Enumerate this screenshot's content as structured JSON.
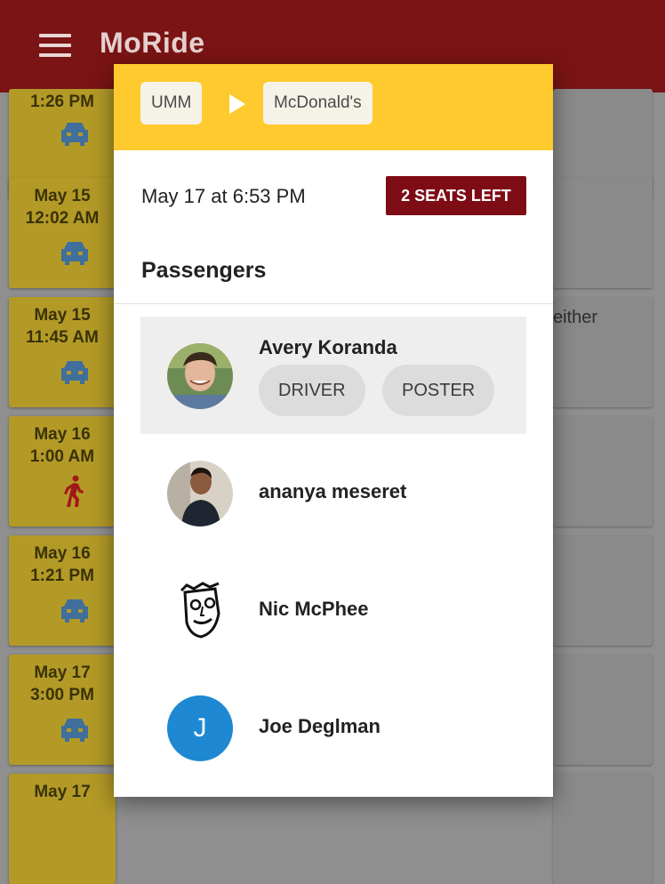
{
  "app": {
    "title": "MoRide"
  },
  "ride_list": [
    {
      "date": "",
      "time": "1:26 PM",
      "mode": "car"
    },
    {
      "date": "May 15",
      "time": "12:02 AM",
      "mode": "car"
    },
    {
      "date": "May 15",
      "time": "11:45 AM",
      "mode": "car",
      "side_text": "either"
    },
    {
      "date": "May 16",
      "time": "1:00 AM",
      "mode": "walk"
    },
    {
      "date": "May 16",
      "time": "1:21 PM",
      "mode": "car"
    },
    {
      "date": "May 17",
      "time": "3:00 PM",
      "mode": "car"
    },
    {
      "date": "May 17",
      "time": "",
      "mode": ""
    }
  ],
  "ride_detail": {
    "origin": "UMM",
    "destination": "McDonald's",
    "datetime": "May 17 at 6:53 PM",
    "seats_badge": "2 SEATS LEFT",
    "passengers_heading": "Passengers",
    "passengers": [
      {
        "name": "Avery Koranda",
        "tags": [
          "DRIVER",
          "POSTER"
        ],
        "highlighted": true,
        "avatar": "photo-avatar"
      },
      {
        "name": "ananya meseret",
        "tags": [],
        "avatar": "photo-avatar"
      },
      {
        "name": "Nic McPhee",
        "tags": [],
        "avatar": "sketch-avatar"
      },
      {
        "name": "Joe Deglman",
        "tags": [],
        "avatar": "initial-avatar",
        "initial": "J"
      }
    ]
  },
  "colors": {
    "appbar": "#7b1414",
    "header": "#ffca2e",
    "badge": "#7e0c15",
    "card": "#b39a27",
    "car_icon": "#3f6f9a",
    "walk_icon": "#a11818",
    "initial_avatar": "#1e88d2"
  },
  "icons": {
    "menu": "hamburger-menu-icon",
    "arrow": "play-arrow-icon",
    "car": "car-icon",
    "walk": "walking-person-icon"
  }
}
